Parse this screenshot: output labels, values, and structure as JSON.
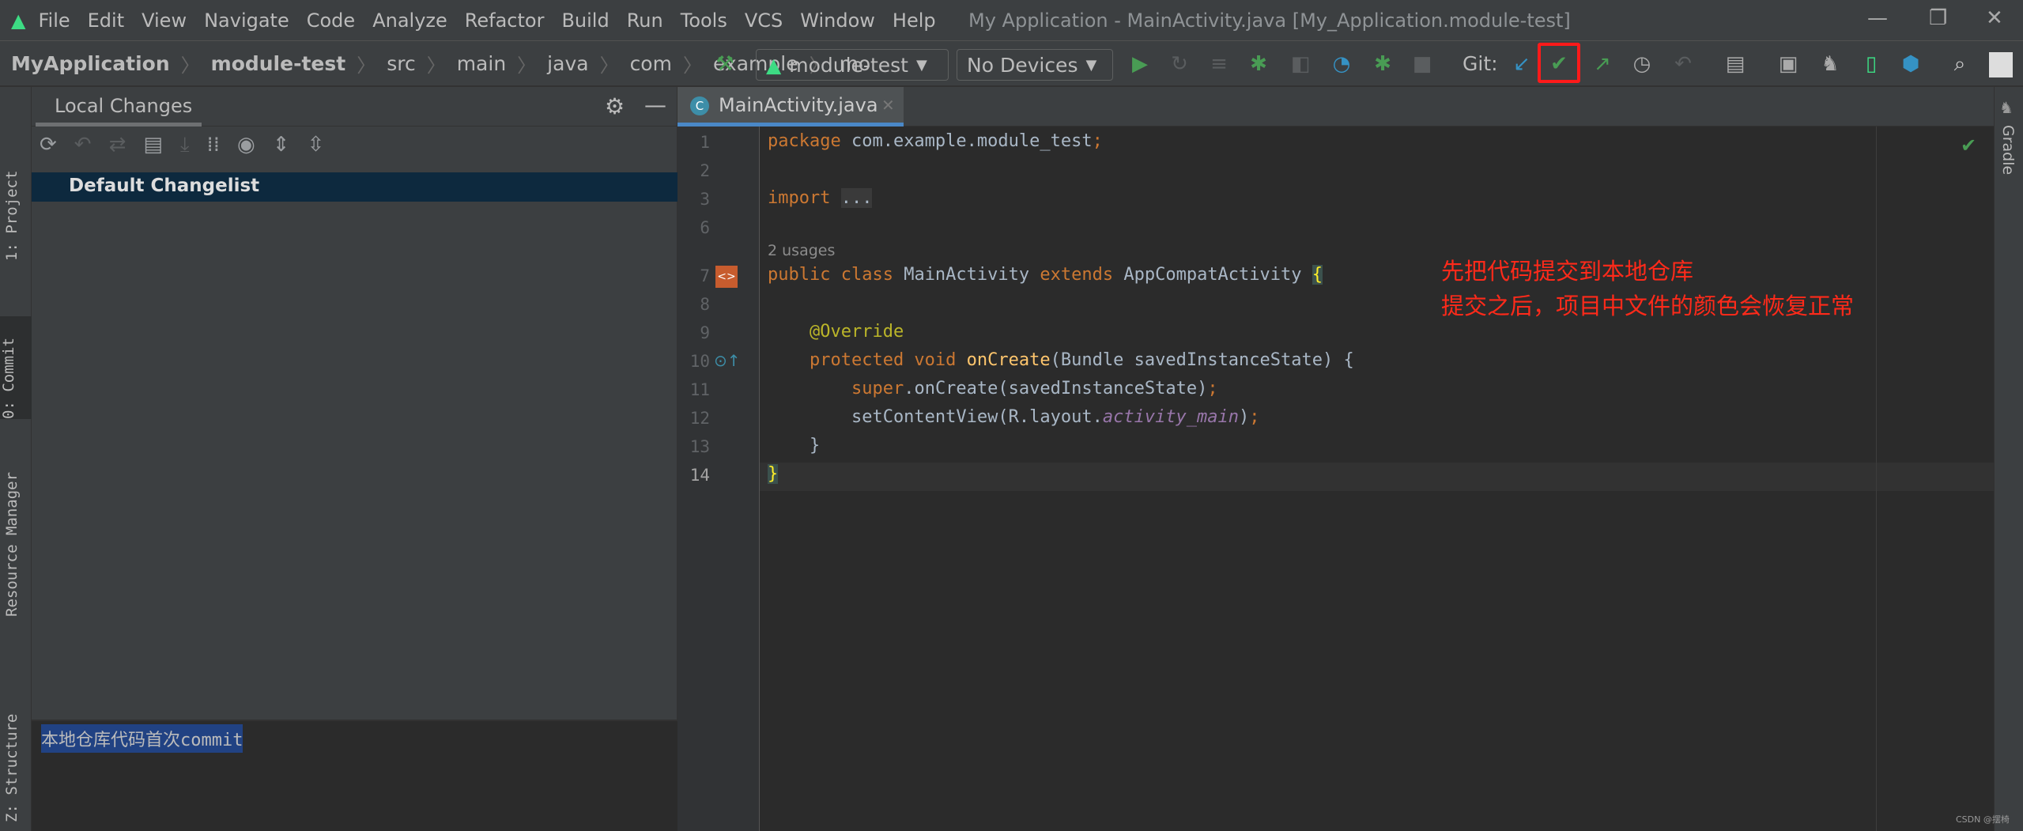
{
  "menu": {
    "items": [
      "File",
      "Edit",
      "View",
      "Navigate",
      "Code",
      "Analyze",
      "Refactor",
      "Build",
      "Run",
      "Tools",
      "VCS",
      "Window",
      "Help"
    ]
  },
  "window": {
    "title": "My Application - MainActivity.java [My_Application.module-test]"
  },
  "breadcrumb": [
    "MyApplication",
    "module-test",
    "src",
    "main",
    "java",
    "com",
    "example",
    "mo"
  ],
  "toolbar": {
    "run_config": "module-test",
    "device": "No Devices",
    "git_label": "Git:"
  },
  "left_panel": {
    "tab": "Local Changes",
    "changelist": "Default Changelist",
    "commit_message": "本地仓库代码首次commit"
  },
  "stripes": {
    "project": "1: Project",
    "commit": "0: Commit",
    "resource_manager": "Resource Manager",
    "structure": "Z: Structure",
    "gradle": "Gradle"
  },
  "editor": {
    "tab": "MainActivity.java",
    "usages": "2 usages",
    "import_fold": "..."
  },
  "annotation": {
    "line1": "先把代码提交到本地仓库",
    "line2": "提交之后，项目中文件的颜色会恢复正常",
    "color": "#ff2a1a"
  },
  "watermark": "CSDN @摆椅"
}
